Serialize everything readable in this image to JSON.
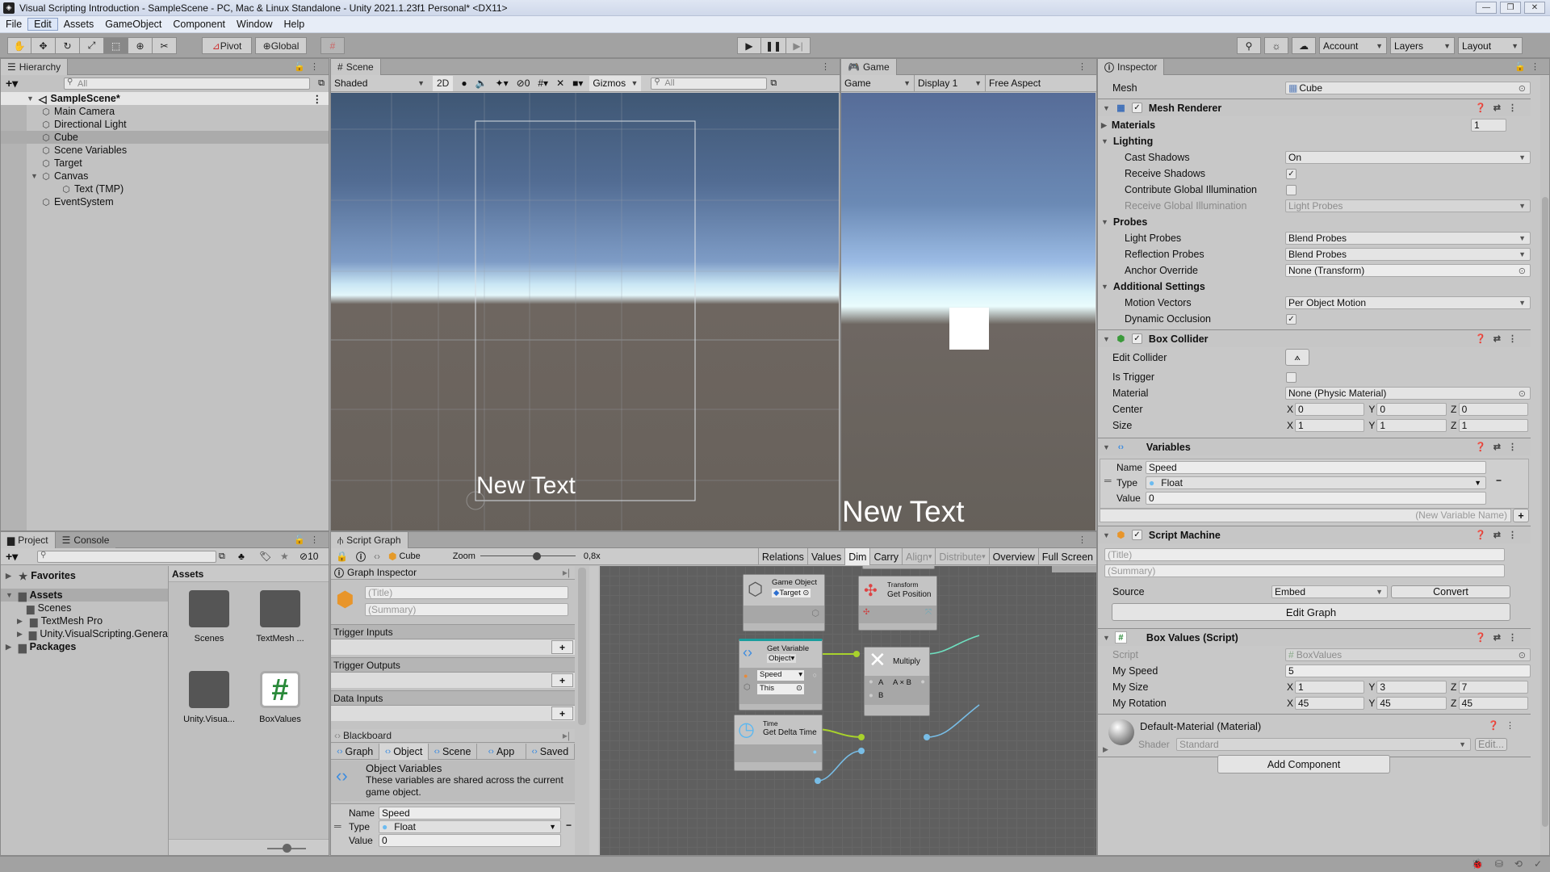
{
  "window": {
    "title": "Visual Scripting Introduction - SampleScene - PC, Mac & Linux Standalone - Unity 2021.1.23f1 Personal* <DX11>",
    "controls": [
      "minimize",
      "maximize",
      "close"
    ]
  },
  "menu": [
    "File",
    "Edit",
    "Assets",
    "GameObject",
    "Component",
    "Window",
    "Help"
  ],
  "toolbar": {
    "tools": [
      "hand-tool",
      "move-tool",
      "rotate-tool",
      "scale-tool",
      "rect-tool",
      "transform-tool",
      "custom-tool"
    ],
    "active_tool": "rect-tool",
    "pivot_label": "Pivot",
    "global_label": "Global",
    "play_controls": [
      "play",
      "pause",
      "step"
    ],
    "account_label": "Account",
    "layers_label": "Layers",
    "layout_label": "Layout"
  },
  "hierarchy": {
    "tab_label": "Hierarchy",
    "search_placeholder": "All",
    "scene_name": "SampleScene*",
    "items": [
      {
        "label": "Main Camera",
        "depth": 1,
        "selected": false
      },
      {
        "label": "Directional Light",
        "depth": 1,
        "selected": false
      },
      {
        "label": "Cube",
        "depth": 1,
        "selected": true
      },
      {
        "label": "Scene Variables",
        "depth": 1,
        "selected": false
      },
      {
        "label": "Target",
        "depth": 1,
        "selected": false
      },
      {
        "label": "Canvas",
        "depth": 1,
        "selected": false,
        "expanded": true
      },
      {
        "label": "Text (TMP)",
        "depth": 2,
        "selected": false
      },
      {
        "label": "EventSystem",
        "depth": 1,
        "selected": false
      }
    ]
  },
  "scene": {
    "tab_label": "Scene",
    "shading_mode": "Shaded",
    "mode_2d_label": "2D",
    "hidden_count": "0",
    "gizmos_label": "Gizmos",
    "search_placeholder": "All",
    "canvas_text": "New Text"
  },
  "game": {
    "tab_label": "Game",
    "view_mode": "Game",
    "display": "Display 1",
    "aspect": "Free Aspect",
    "canvas_text": "New Text"
  },
  "project": {
    "tabs": [
      "Project",
      "Console"
    ],
    "hidden_packages_count": "10",
    "tree": [
      {
        "label": "Favorites",
        "bold": true,
        "depth": 0
      },
      {
        "label": "Assets",
        "bold": true,
        "depth": 0,
        "selected": true
      },
      {
        "label": "Scenes",
        "bold": false,
        "depth": 1
      },
      {
        "label": "TextMesh Pro",
        "bold": false,
        "depth": 1
      },
      {
        "label": "Unity.VisualScripting.Genera",
        "bold": false,
        "depth": 1
      },
      {
        "label": "Packages",
        "bold": true,
        "depth": 0
      }
    ],
    "breadcrumb": "Assets",
    "assets": [
      {
        "label": "Scenes",
        "type": "folder"
      },
      {
        "label": "TextMesh ...",
        "type": "folder"
      },
      {
        "label": "Unity.Visua...",
        "type": "folder"
      },
      {
        "label": "BoxValues",
        "type": "script"
      }
    ]
  },
  "script_graph": {
    "tab_label": "Script Graph",
    "target": "Cube",
    "zoom_label": "Zoom",
    "zoom_value": "0,8x",
    "zoom_fraction": 0.6,
    "toolbar_buttons": [
      "Relations",
      "Values",
      "Dim",
      "Carry",
      "Align",
      "Distribute",
      "Overview",
      "Full Screen"
    ],
    "graph_inspector": {
      "header": "Graph Inspector",
      "title_placeholder": "(Title)",
      "summary_placeholder": "(Summary)",
      "sections": [
        "Trigger Inputs",
        "Trigger Outputs",
        "Data Inputs"
      ]
    },
    "blackboard": {
      "header": "Blackboard",
      "tabs": [
        "Graph",
        "Object",
        "Scene",
        "App",
        "Saved"
      ],
      "active_tab": "Object",
      "heading": "Object Variables",
      "description": "These variables are shared across the current game object.",
      "variable": {
        "name_label": "Name",
        "name": "Speed",
        "type_label": "Type",
        "type": "Float",
        "value_label": "Value",
        "value": "0"
      }
    },
    "nodes": {
      "game_object": {
        "title": "Game Object",
        "value": "Target"
      },
      "get_position": {
        "category": "Transform",
        "title": "Get Position"
      },
      "get_variable": {
        "title": "Get Variable",
        "scope": "Object",
        "name": "Speed",
        "target": "This"
      },
      "multiply": {
        "title": "Multiply",
        "port_a": "A",
        "port_b": "B",
        "output": "A × B"
      },
      "delta_time": {
        "category": "Time",
        "title": "Get Delta Time"
      }
    }
  },
  "inspector": {
    "tab_label": "Inspector",
    "mesh_label": "Mesh",
    "mesh_value": "Cube",
    "mesh_renderer": {
      "title": "Mesh Renderer",
      "enabled": true,
      "materials_label": "Materials",
      "materials_count": "1",
      "lighting_label": "Lighting",
      "cast_shadows_label": "Cast Shadows",
      "cast_shadows": "On",
      "receive_shadows_label": "Receive Shadows",
      "receive_shadows": true,
      "contribute_gi_label": "Contribute Global Illumination",
      "contribute_gi": false,
      "receive_gi_label": "Receive Global Illumination",
      "receive_gi": "Light Probes",
      "probes_label": "Probes",
      "light_probes_label": "Light Probes",
      "light_probes": "Blend Probes",
      "reflection_probes_label": "Reflection Probes",
      "reflection_probes": "Blend Probes",
      "anchor_override_label": "Anchor Override",
      "anchor_override": "None (Transform)",
      "additional_label": "Additional Settings",
      "motion_vectors_label": "Motion Vectors",
      "motion_vectors": "Per Object Motion",
      "dynamic_occlusion_label": "Dynamic Occlusion",
      "dynamic_occlusion": true
    },
    "box_collider": {
      "title": "Box Collider",
      "enabled": true,
      "edit_collider_label": "Edit Collider",
      "is_trigger_label": "Is Trigger",
      "is_trigger": false,
      "material_label": "Material",
      "material": "None (Physic Material)",
      "center_label": "Center",
      "center": {
        "x": "0",
        "y": "0",
        "z": "0"
      },
      "size_label": "Size",
      "size": {
        "x": "1",
        "y": "1",
        "z": "1"
      }
    },
    "variables": {
      "title": "Variables",
      "name_label": "Name",
      "name": "Speed",
      "type_label": "Type",
      "type": "Float",
      "value_label": "Value",
      "value": "0",
      "new_placeholder": "(New Variable Name)"
    },
    "script_machine": {
      "title": "Script Machine",
      "enabled": true,
      "title_placeholder": "(Title)",
      "summary_placeholder": "(Summary)",
      "source_label": "Source",
      "source": "Embed",
      "convert_label": "Convert",
      "edit_graph_label": "Edit Graph"
    },
    "box_values": {
      "title": "Box Values (Script)",
      "script_label": "Script",
      "script": "BoxValues",
      "my_speed_label": "My Speed",
      "my_speed": "5",
      "my_size_label": "My Size",
      "my_size": {
        "x": "1",
        "y": "3",
        "z": "7"
      },
      "my_rotation_label": "My Rotation",
      "my_rotation": {
        "x": "45",
        "y": "45",
        "z": "45"
      }
    },
    "material": {
      "title": "Default-Material (Material)",
      "shader_label": "Shader",
      "shader": "Standard",
      "edit_label": "Edit..."
    },
    "add_component_label": "Add Component"
  },
  "axis_labels": {
    "x": "X",
    "y": "Y",
    "z": "Z"
  }
}
